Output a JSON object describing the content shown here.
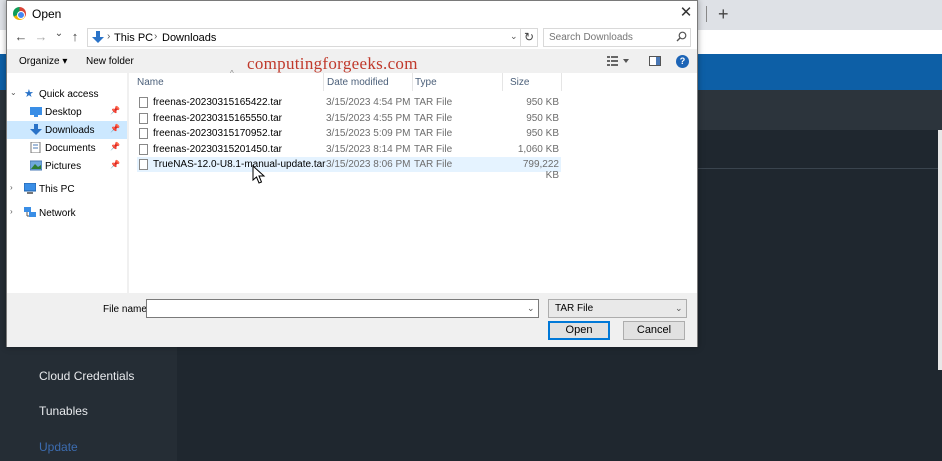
{
  "background": {
    "sidebar_items": [
      "Cloud Credentials",
      "Tunables",
      "Update"
    ],
    "new_tab_symbol": "+"
  },
  "dialog": {
    "title": "Open",
    "close_symbol": "✕",
    "nav": {
      "back": "←",
      "forward": "→",
      "recent": "⌄",
      "up": "↑"
    },
    "address": {
      "parts": [
        "This PC",
        "Downloads"
      ],
      "separator": "›"
    },
    "refresh_symbol": "↻",
    "search": {
      "placeholder": "Search Downloads"
    },
    "command_bar": {
      "organize": "Organize",
      "organize_arrow": "▾",
      "new_folder": "New folder",
      "help": "?"
    },
    "nav_pane": {
      "items": [
        {
          "label": "Quick access",
          "icon": "star-icon",
          "pinned": false
        },
        {
          "label": "Desktop",
          "icon": "desktop-folder-icon",
          "pinned": true
        },
        {
          "label": "Downloads",
          "icon": "download-folder-icon",
          "pinned": true,
          "selected": true
        },
        {
          "label": "Documents",
          "icon": "documents-folder-icon",
          "pinned": true
        },
        {
          "label": "Pictures",
          "icon": "pictures-folder-icon",
          "pinned": true
        },
        {
          "label": "This PC",
          "icon": "computer-icon",
          "pinned": false
        },
        {
          "label": "Network",
          "icon": "network-icon",
          "pinned": false
        }
      ]
    },
    "columns": [
      "Name",
      "Date modified",
      "Type",
      "Size"
    ],
    "files": [
      {
        "name": "freenas-20230315165422.tar",
        "date": "3/15/2023 4:54 PM",
        "type": "TAR File",
        "size": "950 KB"
      },
      {
        "name": "freenas-20230315165550.tar",
        "date": "3/15/2023 4:55 PM",
        "type": "TAR File",
        "size": "950 KB"
      },
      {
        "name": "freenas-20230315170952.tar",
        "date": "3/15/2023 5:09 PM",
        "type": "TAR File",
        "size": "950 KB"
      },
      {
        "name": "freenas-20230315201450.tar",
        "date": "3/15/2023 8:14 PM",
        "type": "TAR File",
        "size": "1,060 KB"
      },
      {
        "name": "TrueNAS-12.0-U8.1-manual-update.tar",
        "date": "3/15/2023 8:06 PM",
        "type": "TAR File",
        "size": "799,222 KB"
      }
    ],
    "watermark": "computingforgeeks.com",
    "file_name_label": "File name:",
    "file_name_value": "",
    "file_type": "TAR File",
    "open_label": "Open",
    "cancel_label": "Cancel"
  },
  "colors": {
    "selection": "#cce8ff",
    "hover": "#e5f3ff",
    "accent": "#0078d7",
    "banner": "#0d5fa6"
  }
}
